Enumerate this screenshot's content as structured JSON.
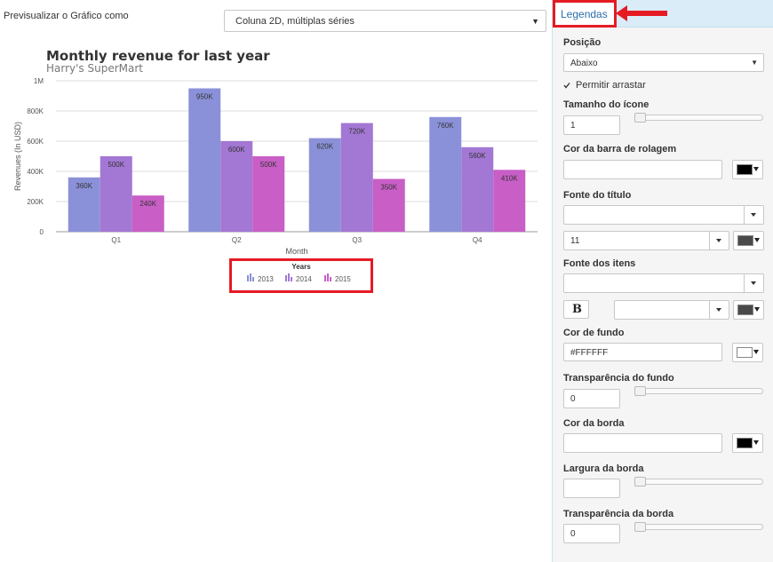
{
  "preview": {
    "label": "Previsualizar o Gráfico como",
    "chart_type_selected": "Coluna 2D, múltiplas séries"
  },
  "chart_data": {
    "type": "bar",
    "title": "Monthly revenue for last year",
    "subtitle": "Harry's SuperMart",
    "xlabel": "Month",
    "ylabel": "Revenues (In USD)",
    "categories": [
      "Q1",
      "Q2",
      "Q3",
      "Q4"
    ],
    "ylim": [
      0,
      1000000
    ],
    "yticks": [
      "0",
      "200K",
      "400K",
      "600K",
      "800K",
      "1M"
    ],
    "legend_title": "Years",
    "legend_position": "bottom",
    "grid": true,
    "series": [
      {
        "name": "2013",
        "color": "#8b91d8",
        "values": [
          360000,
          950000,
          620000,
          760000
        ],
        "labels": [
          "360K",
          "950K",
          "620K",
          "760K"
        ]
      },
      {
        "name": "2014",
        "color": "#a377d4",
        "values": [
          500000,
          600000,
          720000,
          560000
        ],
        "labels": [
          "500K",
          "600K",
          "720K",
          "560K"
        ]
      },
      {
        "name": "2015",
        "color": "#c85ec6",
        "values": [
          240000,
          500000,
          350000,
          410000
        ],
        "labels": [
          "240K",
          "500K",
          "350K",
          "410K"
        ]
      }
    ]
  },
  "panel": {
    "tab_label": "Legendas",
    "accent_color": "#e51b24",
    "position": {
      "label": "Posição",
      "value": "Abaixo"
    },
    "allow_drag": {
      "label": "Permitir arrastar",
      "checked": true
    },
    "icon_size": {
      "label": "Tamanho do ícone",
      "value": "1"
    },
    "scrollbar_color": {
      "label": "Cor da barra de rolagem",
      "value": "",
      "swatch": "#000000"
    },
    "title_font": {
      "label": "Fonte do título",
      "family": "",
      "size": "11",
      "swatch": "#4a4a4a"
    },
    "item_font": {
      "label": "Fonte dos itens",
      "family": "",
      "bold_label": "B",
      "size": "",
      "swatch": "#4a4a4a"
    },
    "bg_color": {
      "label": "Cor de fundo",
      "value": "#FFFFFF",
      "swatch": "#ffffff"
    },
    "bg_alpha": {
      "label": "Transparência do fundo",
      "value": "0"
    },
    "border_color": {
      "label": "Cor da borda",
      "value": "",
      "swatch": "#000000"
    },
    "border_width": {
      "label": "Largura da borda",
      "value": ""
    },
    "border_alpha": {
      "label": "Transparência da borda",
      "value": "0"
    }
  }
}
